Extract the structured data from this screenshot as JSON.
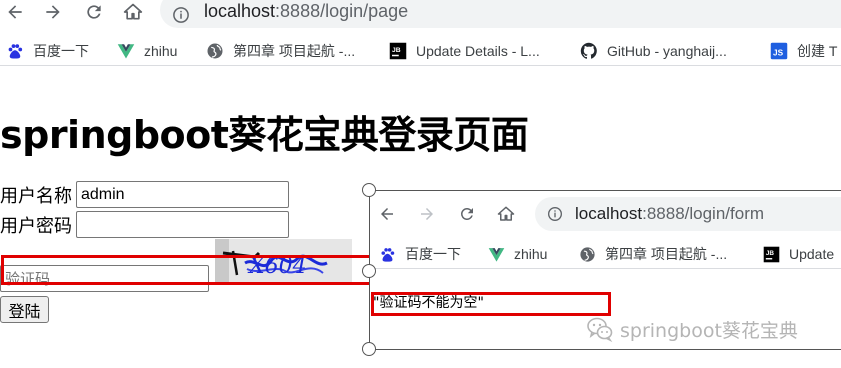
{
  "browser": {
    "url_host": "localhost",
    "url_rest": ":8888/login/page",
    "bookmarks": [
      {
        "label": "百度一下",
        "icon": "baidu-paw-icon"
      },
      {
        "label": "zhihu",
        "icon": "vue-logo-icon"
      },
      {
        "label": "第四章 项目起航 -...",
        "icon": "globe-icon"
      },
      {
        "label": "Update Details - L...",
        "icon": "jetbrains-icon"
      },
      {
        "label": "GitHub - yanghaij...",
        "icon": "github-icon"
      },
      {
        "label": "创建 T",
        "icon": "js-icon"
      }
    ]
  },
  "page": {
    "title": "springboot葵花宝典登录页面",
    "username_label": "用户名称",
    "username_value": "admin",
    "password_label": "用户密码",
    "password_value": "",
    "captcha_placeholder": "验证码",
    "captcha_text": "X604",
    "login_button": "登陆"
  },
  "inset": {
    "url_host": "localhost",
    "url_rest": ":8888/login/form",
    "bookmarks": [
      {
        "label": "百度一下",
        "icon": "baidu-paw-icon"
      },
      {
        "label": "zhihu",
        "icon": "vue-logo-icon"
      },
      {
        "label": "第四章 项目起航 -...",
        "icon": "globe-icon"
      },
      {
        "label": "Update",
        "icon": "jetbrains-icon"
      }
    ],
    "result_text": "\"验证码不能为空\""
  },
  "watermark": {
    "text": "springboot葵花宝典",
    "icon": "wechat-icon"
  },
  "colors": {
    "highlight_red": "#e00000",
    "omnibox_bg": "#f1f3f4",
    "baidu_blue": "#2932e1",
    "vue_green": "#41b883",
    "js_blue": "#1f5fe0"
  }
}
